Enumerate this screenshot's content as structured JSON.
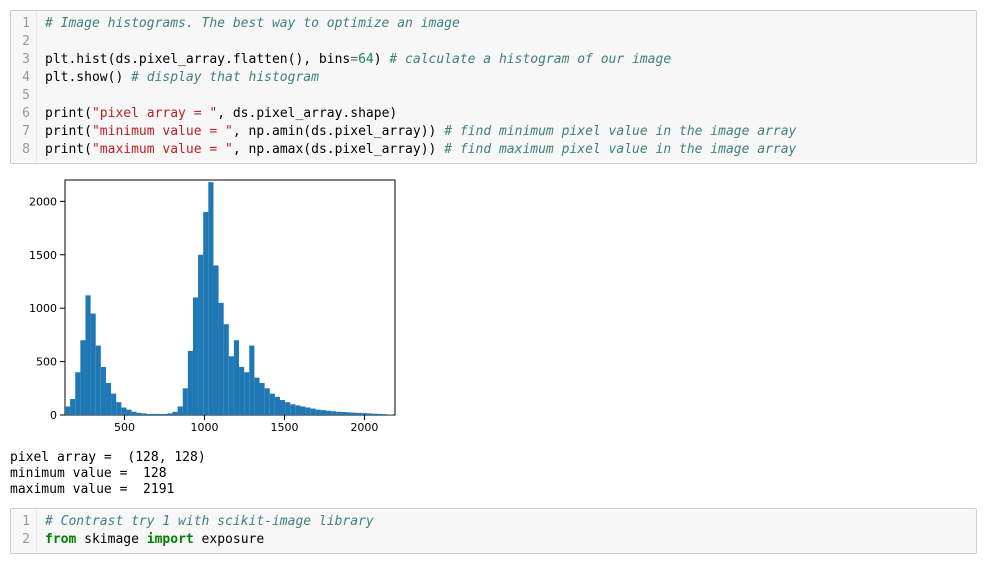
{
  "cell1": {
    "lines": [
      "1",
      "2",
      "3",
      "4",
      "5",
      "6",
      "7",
      "8"
    ],
    "l1_comment": "# Image histograms. The best way to optimize an image",
    "l3_pre": "plt.hist(ds.pixel_array.flatten(), bins",
    "l3_eq": "=",
    "l3_num": "64",
    "l3_post": ") ",
    "l3_comment": "# calculate a histogram of our image",
    "l4_pre": "plt.show() ",
    "l4_comment": "# display that histogram",
    "l6_pre": "print(",
    "l6_str": "\"pixel array = \"",
    "l6_post": ", ds.pixel_array.shape)",
    "l7_pre": "print(",
    "l7_str": "\"minimum value = \"",
    "l7_post": ", np.amin(ds.pixel_array)) ",
    "l7_comment": "# find minimum pixel value in the image array",
    "l8_pre": "print(",
    "l8_str": "\"maximum value = \"",
    "l8_post": ", np.amax(ds.pixel_array)) ",
    "l8_comment": "# find maximum pixel value in the image array"
  },
  "output_text": "pixel array =  (128, 128)\nminimum value =  128\nmaximum value =  2191",
  "cell2": {
    "lines": [
      "1",
      "2"
    ],
    "l1_comment": "# Contrast try 1 with scikit-image library",
    "l2_kw1": "from",
    "l2_mid": " skimage ",
    "l2_kw2": "import",
    "l2_post": " exposure"
  },
  "chart_data": {
    "type": "bar",
    "title": "",
    "xlabel": "",
    "ylabel": "",
    "xlim": [
      128,
      2191
    ],
    "ylim": [
      0,
      2200
    ],
    "xticks": [
      500,
      1000,
      1500,
      2000
    ],
    "yticks": [
      0,
      500,
      1000,
      1500,
      2000
    ],
    "bin_width": 32,
    "categories": [
      144,
      176,
      208,
      240,
      272,
      304,
      336,
      368,
      400,
      432,
      464,
      496,
      528,
      560,
      592,
      624,
      656,
      688,
      720,
      752,
      784,
      816,
      848,
      880,
      912,
      944,
      976,
      1008,
      1040,
      1072,
      1104,
      1136,
      1168,
      1200,
      1232,
      1264,
      1296,
      1328,
      1360,
      1392,
      1424,
      1456,
      1488,
      1520,
      1552,
      1584,
      1616,
      1648,
      1680,
      1712,
      1744,
      1776,
      1808,
      1840,
      1872,
      1904,
      1936,
      1968,
      2000,
      2032,
      2064,
      2096,
      2128,
      2160
    ],
    "values": [
      80,
      150,
      400,
      700,
      1120,
      950,
      650,
      450,
      300,
      200,
      120,
      70,
      50,
      30,
      20,
      15,
      10,
      10,
      10,
      10,
      15,
      30,
      80,
      250,
      600,
      1100,
      1500,
      1900,
      2180,
      1400,
      1050,
      850,
      550,
      700,
      450,
      400,
      650,
      350,
      300,
      250,
      200,
      170,
      140,
      120,
      100,
      90,
      80,
      70,
      60,
      50,
      45,
      40,
      35,
      30,
      28,
      25,
      22,
      20,
      18,
      15,
      12,
      10,
      8,
      5
    ],
    "bar_color": "#1f77b4"
  }
}
